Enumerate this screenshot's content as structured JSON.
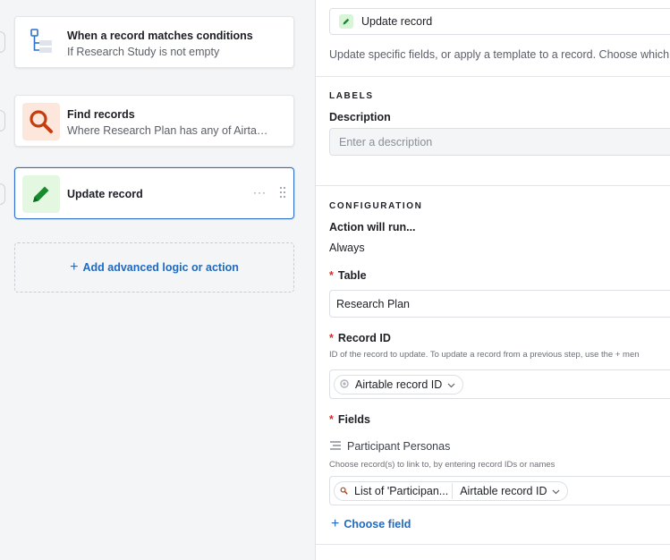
{
  "steps": [
    {
      "title": "When a record matches conditions",
      "subtitle": "If Research Study is not empty",
      "icon": "trigger-tree-icon"
    },
    {
      "title": "Find records",
      "subtitle": "Where Research Plan has any of Airta…",
      "icon": "search-icon"
    },
    {
      "title": "Update record",
      "subtitle": "",
      "icon": "pencil-icon"
    }
  ],
  "add_logic_label": "Add advanced logic or action",
  "panel": {
    "action_type": "Update record",
    "action_description": "Update specific fields, or apply a template to a record. Choose which r",
    "labels_heading": "LABELS",
    "description_label": "Description",
    "description_placeholder": "Enter a description",
    "configuration_heading": "CONFIGURATION",
    "action_will_run_label": "Action will run...",
    "action_will_run_value": "Always",
    "table_label": "Table",
    "table_value": "Research Plan",
    "record_id_label": "Record ID",
    "record_id_help": "ID of the record to update. To update a record from a previous step, use the + men",
    "record_id_token": "Airtable record ID",
    "fields_label": "Fields",
    "field_name": "Participant Personas",
    "field_help": "Choose record(s) to link to, by entering record IDs or names",
    "field_token_list": "List of 'Participan...",
    "field_token_id": "Airtable record ID",
    "choose_field_label": "Choose field"
  },
  "colors": {
    "accent": "#2d6fd1",
    "link": "#1f6ac1",
    "required": "#d12e2e",
    "update_green": "#e3f7e1",
    "find_orange": "#fde6dc"
  }
}
